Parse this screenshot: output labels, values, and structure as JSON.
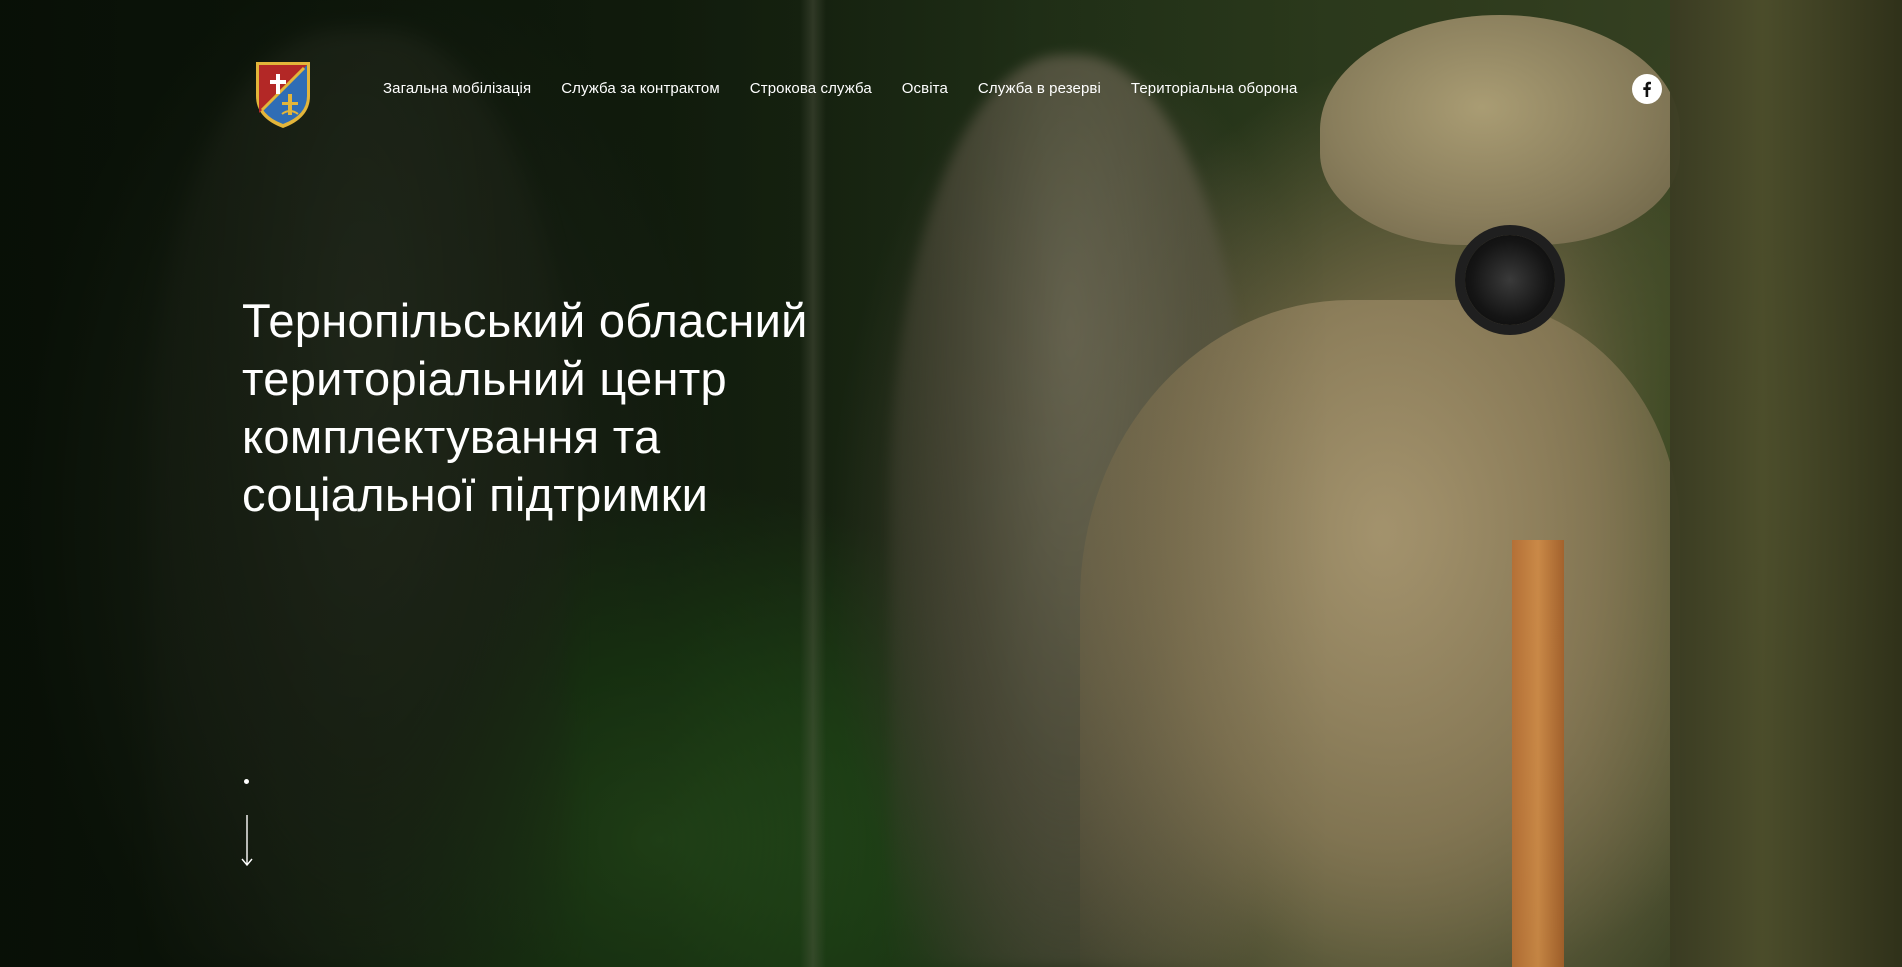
{
  "header": {
    "logo_icon": "regional-coat-of-arms-icon",
    "nav": [
      {
        "label": "Загальна мобілізація"
      },
      {
        "label": "Служба за контрактом"
      },
      {
        "label": "Строкова служба"
      },
      {
        "label": "Освіта"
      },
      {
        "label": "Служба в резерві"
      },
      {
        "label": "Територіальна оборона"
      }
    ],
    "social": {
      "icon": "facebook-icon",
      "label": "f"
    }
  },
  "hero": {
    "title": "Тернопільський обласний\nтериторіальний центр\nкомплектування та\nсоціальної підтримки",
    "scroll_icon": "scroll-down-arrow-icon"
  },
  "colors": {
    "text": "#ffffff",
    "logo_red": "#b32826",
    "logo_blue": "#2f6db5",
    "logo_gold": "#e3b53a"
  }
}
